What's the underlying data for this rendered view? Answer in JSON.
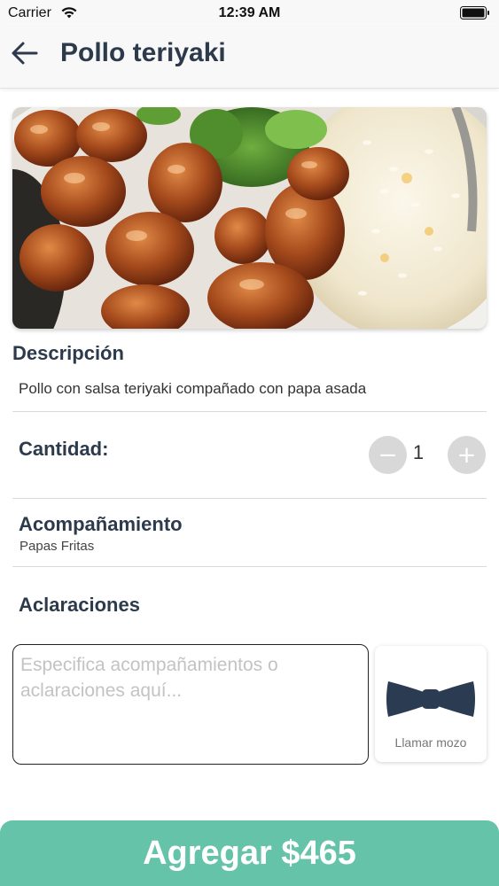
{
  "status_bar": {
    "carrier": "Carrier",
    "time": "12:39 AM"
  },
  "header": {
    "title": "Pollo teriyaki",
    "back_icon": "arrow-left-icon"
  },
  "description": {
    "title": "Descripción",
    "text": "Pollo con salsa teriyaki compañado con papa asada"
  },
  "quantity": {
    "label": "Cantidad:",
    "value": "1",
    "minus_symbol": "−",
    "plus_symbol": "+"
  },
  "side": {
    "title": "Acompañamiento",
    "value": "Papas Fritas"
  },
  "notes": {
    "title": "Aclaraciones",
    "value": "",
    "placeholder": "Especifica acompañamientos o aclaraciones aquí..."
  },
  "waiter": {
    "label": "Llamar mozo",
    "icon": "bowtie-icon",
    "icon_color": "#2a3b52"
  },
  "footer": {
    "add_label": "Agregar $465",
    "color": "#64c3a8"
  }
}
